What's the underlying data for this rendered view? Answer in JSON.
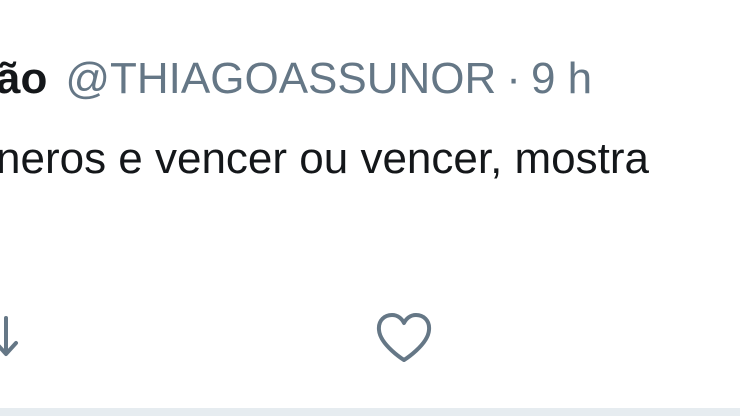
{
  "tweet": {
    "display_name": "ão",
    "handle": "@THIAGOASSUNOR",
    "separator": "·",
    "time": "9 h",
    "text": "neros e vencer ou vencer, mostra"
  },
  "actions": {
    "reply_icon": "reply-arrow-icon",
    "like_icon": "heart-outline-icon"
  },
  "colors": {
    "text": "#14171a",
    "secondary": "#657786",
    "icon": "#657786",
    "divider": "#e6ecf0"
  }
}
